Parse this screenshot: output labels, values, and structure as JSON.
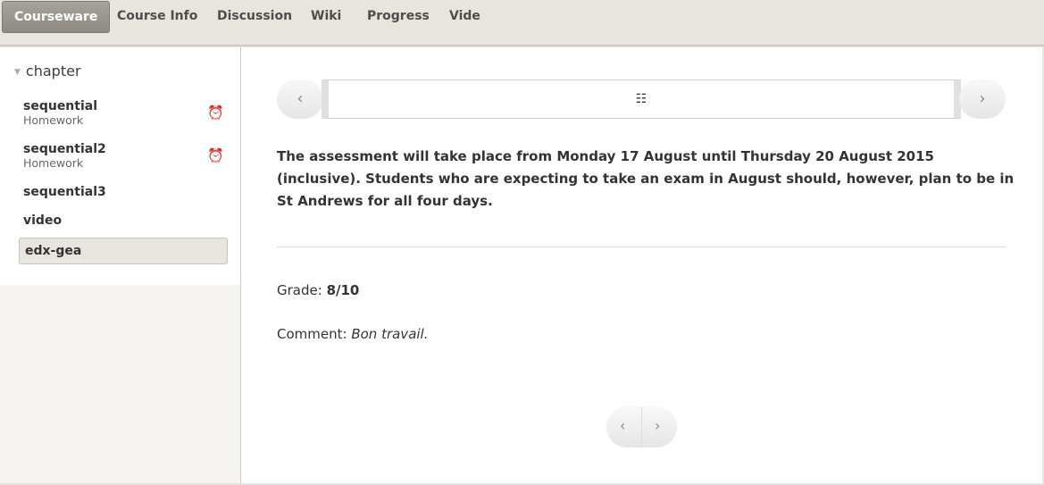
{
  "tabs": [
    "Courseware",
    "Course Info",
    "Discussion",
    "Wiki",
    "Progress",
    "Vide"
  ],
  "sidebar": {
    "chapter": "chapter",
    "items": [
      {
        "label": "sequential",
        "sub": "Homework"
      },
      {
        "label": "sequential2",
        "sub": "Homework"
      },
      {
        "label": "sequential3"
      },
      {
        "label": "video"
      },
      {
        "label": "edx-gea"
      }
    ]
  },
  "main": {
    "text": "The assessment  will take place from Monday 17 August until Thursday 20 August 2015 (inclusive). Students who are expecting to take an exam in August should, however, plan to be in St Andrews for all four days.",
    "grade_label": "Grade: ",
    "grade": "8/10",
    "comment_label": "Comment: ",
    "comment": "Bon travail."
  },
  "colors": {
    "accent": "#1c9ce0",
    "active_tab": "#9b978f"
  }
}
